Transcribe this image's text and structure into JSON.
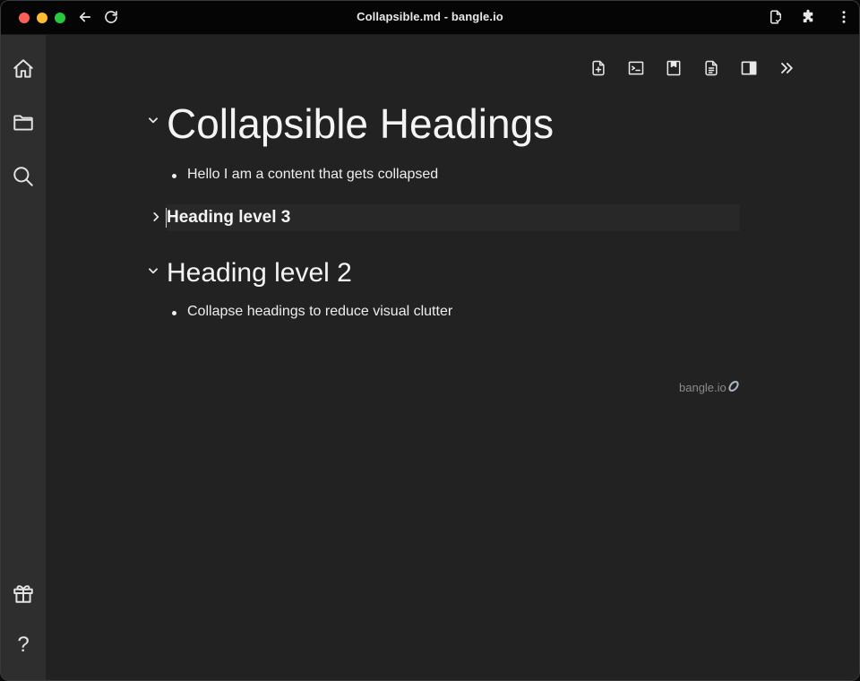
{
  "window": {
    "title": "Collapsible.md - bangle.io"
  },
  "titlebar": {
    "icons": [
      "back-icon",
      "reload-icon",
      "document-icon",
      "extension-icon",
      "more-vertical-icon"
    ]
  },
  "activitybar": {
    "top_icons": [
      "home-icon",
      "folder-icon",
      "search-icon"
    ],
    "bottom_icons": [
      "gift-icon",
      "help-icon"
    ],
    "help_label": "?"
  },
  "toolbar": {
    "buttons": [
      "new-note-icon",
      "terminal-icon",
      "bookmark-icon",
      "document-icon",
      "sidebar-icon",
      "chevrons-right-icon"
    ]
  },
  "editor": {
    "h1": {
      "text": "Collapsible Headings",
      "collapsed": false
    },
    "h1_items": [
      "Hello I am a content that gets collapsed"
    ],
    "h3": {
      "text": "Heading level 3",
      "collapsed": true
    },
    "h2": {
      "text": "Heading level 2",
      "collapsed": false
    },
    "h2_items": [
      "Collapse headings to reduce visual clutter"
    ]
  },
  "footer": {
    "brand": "bangle.io"
  },
  "colors": {
    "background": "#222222",
    "activitybar": "#2e2e2e",
    "titlebar": "#050505",
    "text": "#f4f4f4",
    "muted": "#8a8a8a"
  }
}
